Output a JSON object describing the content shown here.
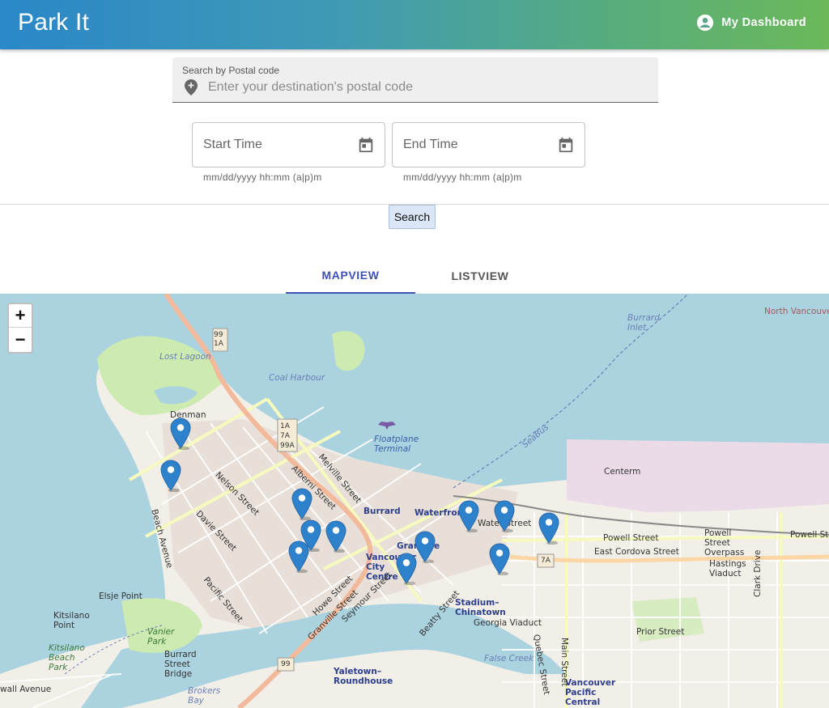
{
  "header": {
    "brand": "Park It",
    "dashboard_label": "My Dashboard"
  },
  "search": {
    "postal_label": "Search by Postal code",
    "postal_placeholder": "Enter your destination's postal code",
    "start_placeholder": "Start Time",
    "end_placeholder": "End Time",
    "start_helper": "mm/dd/yyyy hh:mm (a|p)m",
    "end_helper": "mm/dd/yyyy hh:mm (a|p)m",
    "button_label": "Search"
  },
  "tabs": [
    {
      "label": "MAPVIEW",
      "active": true
    },
    {
      "label": "LISTVIEW",
      "active": false
    }
  ],
  "map": {
    "zoom_in": "+",
    "zoom_out": "−",
    "marker_count": 12,
    "labels": {
      "lost_lagoon": "Lost Lagoon",
      "coal_harbour": "Coal Harbour",
      "denman": "Denman",
      "floatplane": "Floatplane Terminal",
      "seabus": "SeaBus",
      "centerm": "Centerm",
      "burrard_inlet": "Burrard Inlet",
      "north_vancouver": "North Vancouver",
      "burrard": "Burrard",
      "waterfront": "Waterfront",
      "vancouver_city_centre": "Vancouver City Centre",
      "granville": "Granville",
      "stadium_chinatown": "Stadium–Chinatown",
      "yaletown": "Yaletown–Roundhouse",
      "false_creek": "False Creek",
      "vancouver_pacific_central": "Vancouver Pacific Central",
      "elsje_point": "Elsje Point",
      "kitsilano_point": "Kitsilano Point",
      "kitsilano_beach_park": "Kitsilano Beach Park",
      "vanier_park": "Vanier Park",
      "burrard_street_bridge": "Burrard Street Bridge",
      "cornwall_avenue": "wall Avenue",
      "brokers_bay": "Brokers Bay",
      "powell_street": "Powell Street",
      "powell_overpass": "Powell Street Overpass",
      "hastings_viaduct": "Hastings Viaduct",
      "east_cordova": "East Cordova Street",
      "prior_street": "Prior Street",
      "georgia_viaduct": "Georgia Viaduct",
      "clark_drive": "Clark Drive",
      "quebec_street": "Quebec Street",
      "main_street": "Main Street",
      "nelson_street": "Nelson Street",
      "davie_street": "Davie Street",
      "pacific_street": "Pacific Street",
      "beach_avenue": "Beach Avenue",
      "alberni_street": "Alberni Street",
      "melville_street": "Melville Street",
      "howe_street": "Howe Street",
      "granville_street": "Granville Street",
      "seymour_street": "Seymour Street",
      "beatty_street": "Beatty Street",
      "water_street": "Water Street",
      "hwy_99_1a": "99 1A",
      "hwy_1a_7a_99a": "1A 7A 99A",
      "hwy_7a": "7A",
      "hwy_99": "99"
    }
  }
}
